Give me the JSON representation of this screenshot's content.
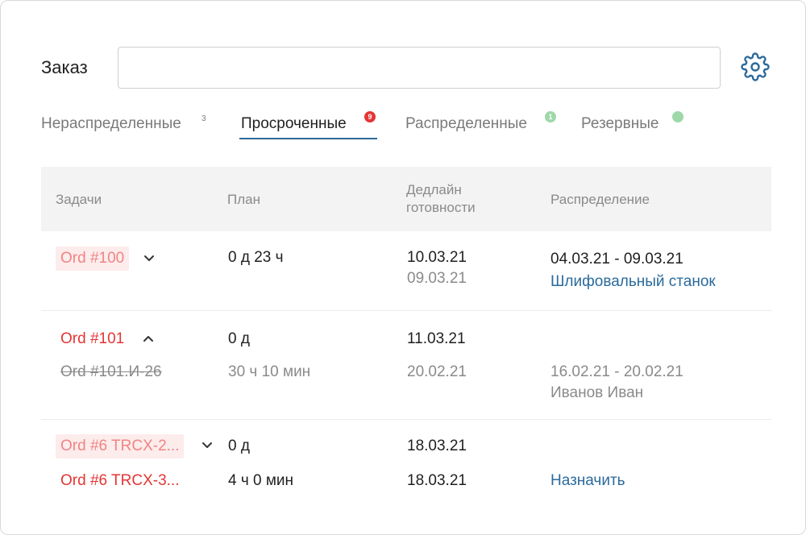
{
  "search": {
    "label": "Заказ",
    "value": "",
    "placeholder": ""
  },
  "settings_icon": "gear-icon",
  "tabs": [
    {
      "label": "Нераспределенные",
      "count": "3",
      "badge_style": "plain"
    },
    {
      "label": "Просроченные",
      "count": "9",
      "badge_style": "red",
      "active": true
    },
    {
      "label": "Распределенные",
      "count": "1",
      "badge_style": "green"
    },
    {
      "label": "Резервные",
      "count": "",
      "badge_style": "green-dot"
    }
  ],
  "table": {
    "headers": {
      "tasks": "Задачи",
      "plan": "План",
      "deadline_line1": "Дедлайн",
      "deadline_line2": "готовности",
      "distribution": "Распределение"
    },
    "rows": [
      {
        "task": "Ord #100",
        "plan": "0 д 23 ч",
        "deadline": "10.03.21",
        "deadline_secondary": "09.03.21",
        "distribution_dates": "04.03.21 - 09.03.21",
        "distribution_link": "Шлифовальный станок"
      },
      {
        "task": "Ord #101",
        "plan": "0 д",
        "deadline": "11.03.21",
        "sub": {
          "task": "Ord #101.И-26",
          "plan": "30 ч 10 мин",
          "deadline": "20.02.21",
          "distribution_dates": "16.02.21 - 20.02.21",
          "distribution_person": "Иванов Иван"
        }
      },
      {
        "task": "Ord #6 TRCX-2...",
        "plan": "0 д",
        "deadline": "18.03.21",
        "sub": {
          "task": "Ord #6 TRCX-3...",
          "plan": "4 ч 0 мин",
          "deadline": "18.03.21",
          "action": "Назначить"
        }
      }
    ]
  },
  "colors": {
    "accent": "#2b6a9b",
    "overdue": "#e53535",
    "overdue_soft": "#f08484",
    "badge_green": "#9fd8a8"
  }
}
